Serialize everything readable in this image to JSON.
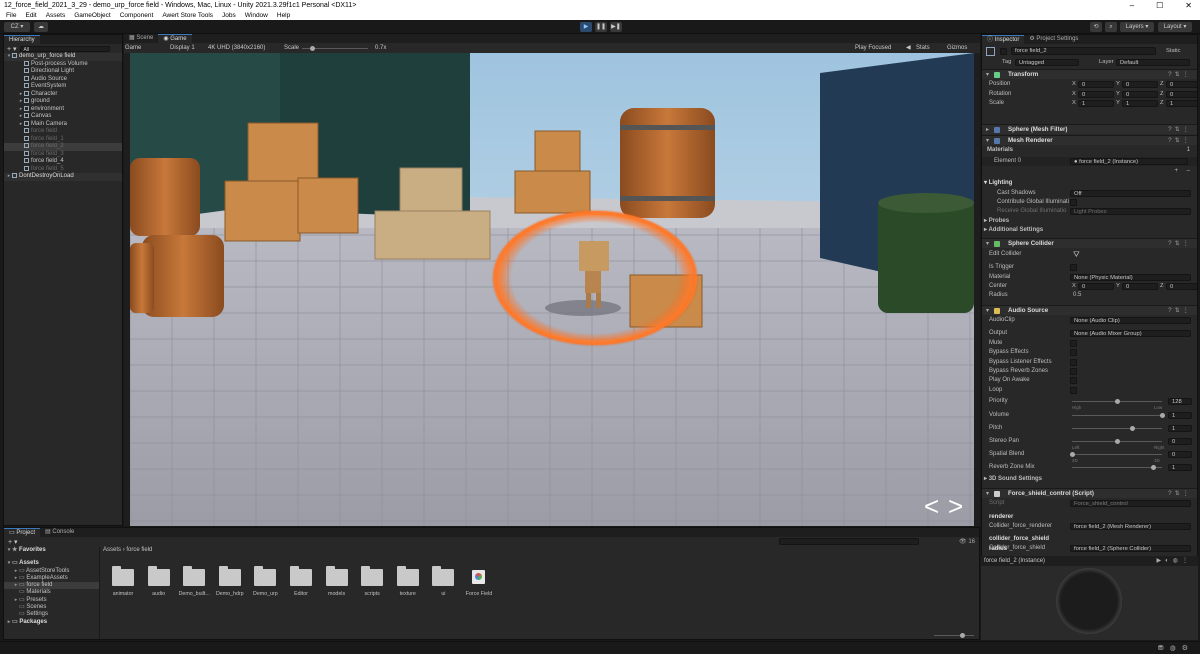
{
  "window": {
    "title": "12_force_field_2021_3_29 - demo_urp_force field - Windows, Mac, Linux - Unity 2021.3.29f1c1 Personal <DX11>",
    "controls": [
      "–",
      "☐",
      "✕"
    ]
  },
  "menu": [
    "File",
    "Edit",
    "Assets",
    "GameObject",
    "Component",
    "Awert Store Tools",
    "Jobs",
    "Window",
    "Help"
  ],
  "toolbar": {
    "account": "CZ ▾",
    "play": "▶",
    "pause": "❚❚",
    "step": "▶❚",
    "layers": "Layers ▾",
    "layout": "Layout ▾"
  },
  "hierarchy": {
    "tab": "Hierarchy",
    "search": "All",
    "items": [
      {
        "label": "demo_urp_force field",
        "indent": 0,
        "style": "root",
        "arrow": "▾"
      },
      {
        "label": "Post-process Volume",
        "indent": 2,
        "style": "",
        "arrow": ""
      },
      {
        "label": "Directional Light",
        "indent": 2,
        "style": "",
        "arrow": ""
      },
      {
        "label": "Audio Source",
        "indent": 2,
        "style": "",
        "arrow": ""
      },
      {
        "label": "EventSystem",
        "indent": 2,
        "style": "",
        "arrow": ""
      },
      {
        "label": "Character",
        "indent": 2,
        "style": "",
        "arrow": "▸"
      },
      {
        "label": "ground",
        "indent": 2,
        "style": "",
        "arrow": "▸"
      },
      {
        "label": "environment",
        "indent": 2,
        "style": "",
        "arrow": "▸"
      },
      {
        "label": "Canvas",
        "indent": 2,
        "style": "",
        "arrow": "▸"
      },
      {
        "label": "Main Camera",
        "indent": 2,
        "style": "",
        "arrow": "▸"
      },
      {
        "label": "force field",
        "indent": 2,
        "style": "dim",
        "arrow": ""
      },
      {
        "label": "force field_1",
        "indent": 2,
        "style": "dim",
        "arrow": ""
      },
      {
        "label": "force field_2",
        "indent": 2,
        "style": "sel dim",
        "arrow": ""
      },
      {
        "label": "force field_3",
        "indent": 2,
        "style": "dim",
        "arrow": ""
      },
      {
        "label": "force field_4",
        "indent": 2,
        "style": "",
        "arrow": ""
      },
      {
        "label": "force field_5",
        "indent": 2,
        "style": "dim",
        "arrow": ""
      },
      {
        "label": "DontDestroyOnLoad",
        "indent": 0,
        "style": "root",
        "arrow": "▸"
      }
    ]
  },
  "scene_tabs": {
    "scene": "Scene",
    "game": "Game"
  },
  "game_bar": {
    "mode": "Game",
    "display": "Display 1",
    "resolution": "4K UHD (3840x2160)",
    "scale_label": "Scale",
    "scale_value": "0.7x",
    "scale_fraction": 0.16,
    "play_focused": "Play Focused",
    "stats": "Stats",
    "gizmos": "Gizmos"
  },
  "game_view": {
    "prev": "<",
    "next": ">"
  },
  "inspector": {
    "tabs": {
      "inspector": "Inspector",
      "project_settings": "Project Settings"
    },
    "object_name": "force field_2",
    "static_label": "Static",
    "tag_label": "Tag",
    "tag_value": "Untagged",
    "layer_label": "Layer",
    "layer_value": "Default",
    "transform": {
      "title": "Transform",
      "rows": [
        {
          "label": "Position",
          "x": "0",
          "y": "0",
          "z": "0"
        },
        {
          "label": "Rotation",
          "x": "0",
          "y": "0",
          "z": "0"
        },
        {
          "label": "Scale",
          "x": "1",
          "y": "1",
          "z": "1"
        }
      ]
    },
    "mesh_filter": {
      "title": "Sphere (Mesh Filter)"
    },
    "mesh_renderer": {
      "title": "Mesh Renderer",
      "materials_label": "Materials",
      "materials_count": "1",
      "element0_label": "Element 0",
      "element0_value": "force field_2 (Instance)",
      "lighting": "Lighting",
      "cast_shadows_label": "Cast Shadows",
      "cast_shadows_value": "Off",
      "contribute_gi": "Contribute Global Illuminati",
      "receive_gi_label": "Receive Global Illuminatio",
      "receive_gi_value": "Light Probes",
      "probes": "Probes",
      "additional": "Additional Settings"
    },
    "sphere_collider": {
      "title": "Sphere Collider",
      "edit_collider": "Edit Collider",
      "is_trigger": "Is Trigger",
      "material_label": "Material",
      "material_value": "None (Physic Material)",
      "center_label": "Center",
      "center": {
        "x": "0",
        "y": "0",
        "z": "0"
      },
      "radius_label": "Radius",
      "radius_value": "0.5"
    },
    "audio_source": {
      "title": "Audio Source",
      "audioclip_label": "AudioClip",
      "audioclip_value": "None (Audio Clip)",
      "output_label": "Output",
      "output_value": "None (Audio Mixer Group)",
      "toggles": [
        "Mute",
        "Bypass Effects",
        "Bypass Listener Effects",
        "Bypass Reverb Zones",
        "Play On Awake",
        "Loop"
      ],
      "priority_label": "Priority",
      "priority_value": "128",
      "priority_fraction": 0.5,
      "priority_high": "High",
      "priority_low": "Low",
      "volume_label": "Volume",
      "volume_value": "1",
      "volume_fraction": 1.0,
      "pitch_label": "Pitch",
      "pitch_value": "1",
      "pitch_fraction": 0.67,
      "stereo_label": "Stereo Pan",
      "stereo_value": "0",
      "stereo_fraction": 0.5,
      "stereo_left": "Left",
      "stereo_right": "Right",
      "spatial_label": "Spatial Blend",
      "spatial_value": "0",
      "spatial_fraction": 0.0,
      "spatial_2d": "2D",
      "spatial_3d": "3D",
      "reverb_label": "Reverb Zone Mix",
      "reverb_value": "1",
      "reverb_fraction": 0.9,
      "sound3d": "3D Sound Settings"
    },
    "script": {
      "title": "Force_shield_control (Script)",
      "script_label": "Script",
      "script_value": "Force_shield_control",
      "renderer_header": "renderer",
      "collider_renderer_label": "Collider_force_renderer",
      "collider_renderer_value": "force field_2 (Mesh Renderer)",
      "collider_header": "collider_force_shield",
      "collider_shield_label": "Collider_force_shield",
      "collider_shield_value": "force field_2 (Sphere Collider)",
      "radius_header": "radius"
    },
    "preview_label": "force field_2 (Instance)"
  },
  "project": {
    "tabs": {
      "project": "Project",
      "console": "Console"
    },
    "tree": [
      {
        "label": "Favorites",
        "indent": 0,
        "bold": true,
        "arrow": "▾"
      },
      {
        "label": "Assets",
        "indent": 0,
        "bold": true,
        "arrow": "▾"
      },
      {
        "label": "AssetStoreTools",
        "indent": 1,
        "bold": false,
        "arrow": "▸"
      },
      {
        "label": "ExampleAssets",
        "indent": 1,
        "bold": false,
        "arrow": "▸"
      },
      {
        "label": "force field",
        "indent": 1,
        "bold": false,
        "arrow": "▸",
        "sel": true
      },
      {
        "label": "Materials",
        "indent": 1,
        "bold": false,
        "arrow": ""
      },
      {
        "label": "Presets",
        "indent": 1,
        "bold": false,
        "arrow": "▸"
      },
      {
        "label": "Scenes",
        "indent": 1,
        "bold": false,
        "arrow": ""
      },
      {
        "label": "Settings",
        "indent": 1,
        "bold": false,
        "arrow": ""
      },
      {
        "label": "Packages",
        "indent": 0,
        "bold": true,
        "arrow": "▸"
      }
    ],
    "breadcrumb": [
      "Assets",
      "force field"
    ],
    "items": [
      "animator",
      "audio",
      "Demo_built...",
      "Demo_hdrp",
      "Demo_urp",
      "Editor",
      "models",
      "scripts",
      "texture",
      "ui",
      "Force Field"
    ],
    "count": "16"
  },
  "colors": {
    "accent": "#3a79bb",
    "panel": "#282828",
    "background": "#191919",
    "shield_glow": "#ff6a1e"
  }
}
